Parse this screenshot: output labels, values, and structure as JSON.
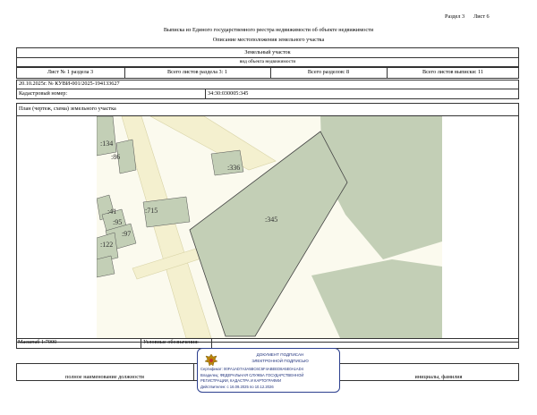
{
  "header": {
    "section_label": "Раздел 3",
    "sheet_label": "Лист 6",
    "title": "Выписка из Единого государственного реестра недвижимости об объекте недвижимости",
    "subtitle": "Описание местоположения земельного участка"
  },
  "object": {
    "type": "Земельный участок",
    "type_caption": "вид объекта недвижимости"
  },
  "sheets_row": {
    "sheet_of_section": "Лист № 1 раздела 3",
    "total_sheets_section": "Всего листов раздела 3: 1",
    "total_sections": "Всего разделов: 8",
    "total_sheets_extract": "Всего листов выписки: 11"
  },
  "record": {
    "date_number": "20.10.2025г. № КУВИ-001/2025-194133627",
    "cadastral_label": "Кадастровый номер:",
    "cadastral_value": "34:30:030005:345"
  },
  "plan": {
    "label": "План (чертеж, схема) земельного участка",
    "parcel_labels": {
      "main": ":345",
      "p336": ":336",
      "p715": ":715",
      "p134": ":134",
      "p86": ":86",
      "p41": ":41",
      "p95": ":95",
      "p97": ":97",
      "p122": ":122"
    },
    "colors": {
      "parcel_fill": "#c3cfb6",
      "road_fill": "#f4f0cf",
      "road_edge": "#d8d3a6",
      "outline": "#555555"
    }
  },
  "footer": {
    "scale": "Масштаб 1:7000",
    "legend_label": "Условные обозначения:",
    "position_caption": "полное наименование должности",
    "name_caption": "инициалы, фамилия"
  },
  "stamp": {
    "line1": "ДОКУМЕНТ ПОДПИСАН",
    "line2": "ЭЛЕКТРОННОЙ ПОДПИСЬЮ",
    "certificate": "Сертификат: 00FA1AD7A3A5BC6C5F4ABEED8A5E0A1AD4",
    "owner_line1": "Владелец: ФЕДЕРАЛЬНАЯ СЛУЖБА ГОСУДАРСТВЕННОЙ",
    "owner_line2": "РЕГИСТРАЦИИ, КАДАСТРА И КАРТОГРАФИИ",
    "valid": "Действителен: с 16.09.2025 по 10.12.2026",
    "border_color": "#2c3f8e",
    "text_color": "#1c2f7a",
    "emblem": "double-headed-eagle-emblem"
  }
}
